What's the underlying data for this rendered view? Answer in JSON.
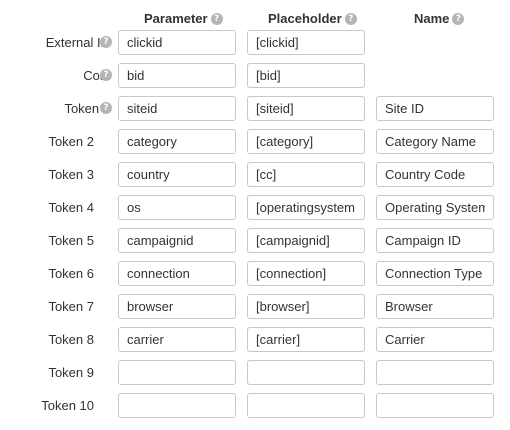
{
  "headers": {
    "parameter": "Parameter",
    "placeholder": "Placeholder",
    "name": "Name",
    "help_glyph": "?"
  },
  "rows": [
    {
      "label": "External ID",
      "help": true,
      "parameter": "clickid",
      "placeholder": "[clickid]",
      "name": null
    },
    {
      "label": "Cost",
      "help": true,
      "parameter": "bid",
      "placeholder": "[bid]",
      "name": null
    },
    {
      "label": "Token 1",
      "help": true,
      "parameter": "siteid",
      "placeholder": "[siteid]",
      "name": "Site ID"
    },
    {
      "label": "Token 2",
      "help": false,
      "parameter": "category",
      "placeholder": "[category]",
      "name": "Category Name"
    },
    {
      "label": "Token 3",
      "help": false,
      "parameter": "country",
      "placeholder": "[cc]",
      "name": "Country Code"
    },
    {
      "label": "Token 4",
      "help": false,
      "parameter": "os",
      "placeholder": "[operatingsystem",
      "name": "Operating System"
    },
    {
      "label": "Token 5",
      "help": false,
      "parameter": "campaignid",
      "placeholder": "[campaignid]",
      "name": "Campaign ID"
    },
    {
      "label": "Token 6",
      "help": false,
      "parameter": "connection",
      "placeholder": "[connection]",
      "name": "Connection Type"
    },
    {
      "label": "Token 7",
      "help": false,
      "parameter": "browser",
      "placeholder": "[browser]",
      "name": "Browser"
    },
    {
      "label": "Token 8",
      "help": false,
      "parameter": "carrier",
      "placeholder": "[carrier]",
      "name": "Carrier"
    },
    {
      "label": "Token 9",
      "help": false,
      "parameter": "",
      "placeholder": "",
      "name": ""
    },
    {
      "label": "Token 10",
      "help": false,
      "parameter": "",
      "placeholder": "",
      "name": ""
    }
  ],
  "colors": {
    "text": "#333333",
    "border": "#c8c8c8",
    "help_icon": "#b5b5b5"
  }
}
